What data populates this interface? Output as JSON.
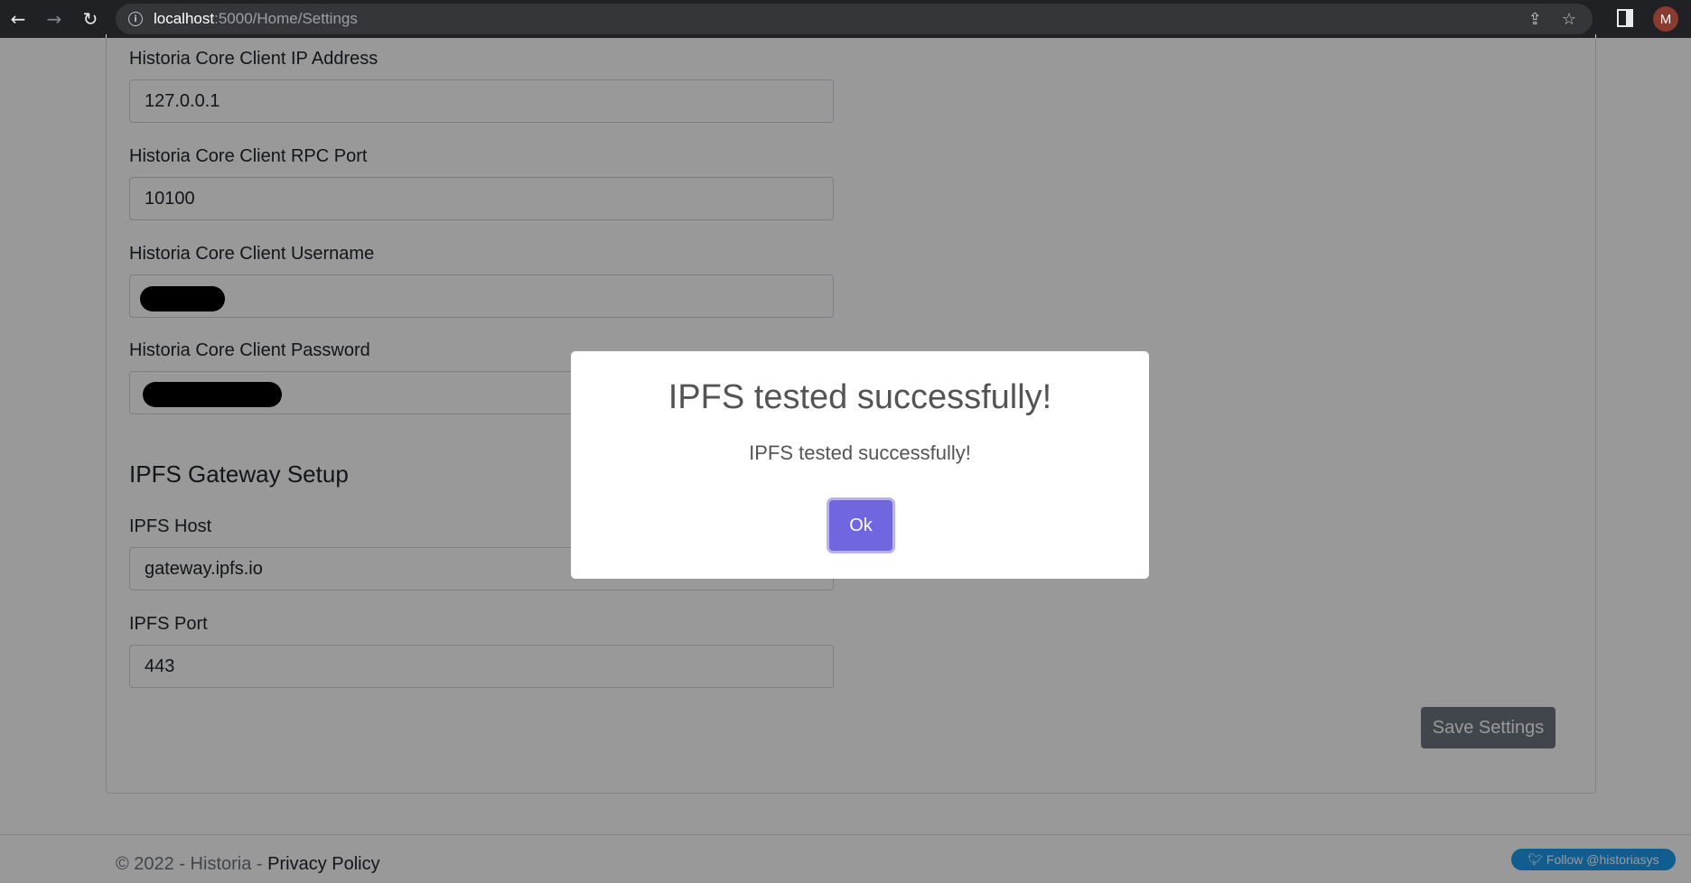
{
  "browser": {
    "url_host": "localhost",
    "url_path": ":5000/Home/Settings",
    "profile_initial": "M",
    "icons": [
      "back-arrow-icon",
      "forward-arrow-icon",
      "reload-icon",
      "info-icon",
      "share-icon",
      "star-icon",
      "side-panel-icon"
    ]
  },
  "form": {
    "ip_label": "Historia Core Client IP Address",
    "ip_value": "127.0.0.1",
    "port_label": "Historia Core Client RPC Port",
    "port_value": "10100",
    "username_label": "Historia Core Client Username",
    "password_label": "Historia Core Client Password",
    "ipfs_section_title": "IPFS Gateway Setup",
    "ipfs_host_label": "IPFS Host",
    "ipfs_host_value": "gateway.ipfs.io",
    "ipfs_port_label": "IPFS Port",
    "ipfs_port_value": "443",
    "save_label": "Save Settings"
  },
  "footer": {
    "copyright": "© 2022 - Historia - ",
    "privacy_link": "Privacy Policy",
    "twitter_label": "Follow @historiasys"
  },
  "modal": {
    "title": "IPFS tested successfully!",
    "text": "IPFS tested successfully!",
    "ok_label": "Ok"
  },
  "colors": {
    "confirm_button": "#7066e0",
    "save_button": "#6c757d",
    "twitter": "#1d9bf0"
  }
}
